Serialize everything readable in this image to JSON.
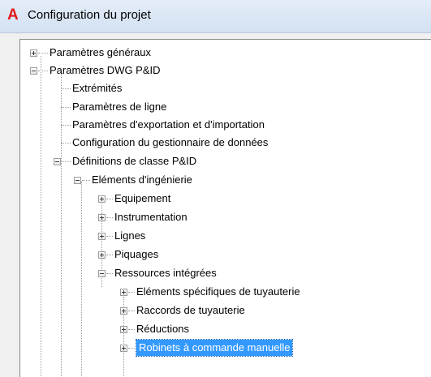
{
  "window": {
    "title": "Configuration du projet",
    "app_icon": "A"
  },
  "tree": {
    "items": [
      {
        "label": "Paramètres généraux",
        "toggle": "plus"
      },
      {
        "label": "Paramètres DWG P&ID",
        "toggle": "minus"
      },
      {
        "label": "Extrémités",
        "toggle": "none"
      },
      {
        "label": "Paramètres de ligne",
        "toggle": "none"
      },
      {
        "label": "Paramètres d'exportation et d'importation",
        "toggle": "none"
      },
      {
        "label": "Configuration du gestionnaire de données",
        "toggle": "none"
      },
      {
        "label": "Définitions de classe P&ID",
        "toggle": "minus"
      },
      {
        "label": "Eléments d'ingénierie",
        "toggle": "minus"
      },
      {
        "label": "Equipement",
        "toggle": "plus"
      },
      {
        "label": "Instrumentation",
        "toggle": "plus"
      },
      {
        "label": "Lignes",
        "toggle": "plus"
      },
      {
        "label": "Piquages",
        "toggle": "plus"
      },
      {
        "label": "Ressources intégrées",
        "toggle": "minus"
      },
      {
        "label": "Eléments spécifiques de tuyauterie",
        "toggle": "plus"
      },
      {
        "label": "Raccords de tuyauterie",
        "toggle": "plus"
      },
      {
        "label": "Réductions",
        "toggle": "plus"
      },
      {
        "label": "Robinets à commande manuelle",
        "toggle": "plus",
        "selected": true
      }
    ]
  },
  "colors": {
    "selection": "#3399ff",
    "app_icon": "#e01b1b"
  }
}
